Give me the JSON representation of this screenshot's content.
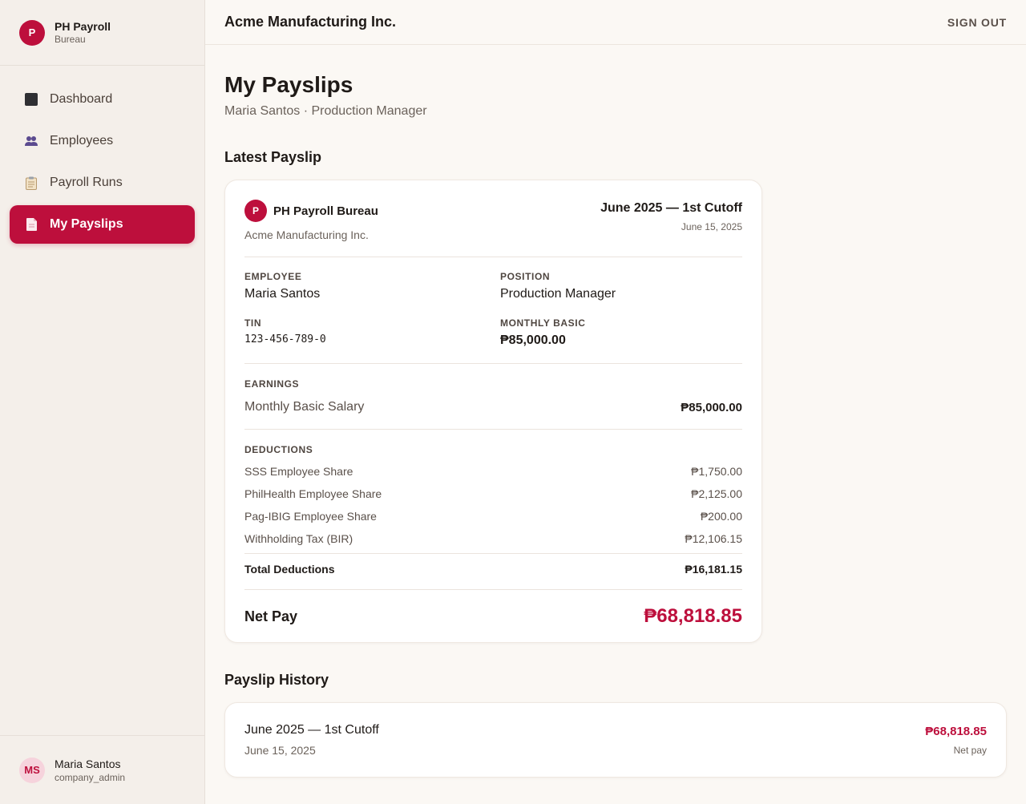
{
  "sidebar": {
    "brand_initial": "P",
    "brand_name": "PH Payroll",
    "brand_sub": "Bureau",
    "items": [
      {
        "label": "Dashboard",
        "icon": "dashboard-square-icon",
        "active": false
      },
      {
        "label": "Employees",
        "icon": "people-icon",
        "active": false
      },
      {
        "label": "Payroll Runs",
        "icon": "clipboard-icon",
        "active": false
      },
      {
        "label": "My Payslips",
        "icon": "document-icon",
        "active": true
      }
    ],
    "user": {
      "initials": "MS",
      "name": "Maria Santos",
      "role": "company_admin"
    }
  },
  "header": {
    "company": "Acme Manufacturing Inc.",
    "signout": "SIGN OUT"
  },
  "page": {
    "title": "My Payslips",
    "subtitle": "Maria Santos · Production Manager"
  },
  "latest": {
    "section_title": "Latest Payslip",
    "bureau_initial": "P",
    "bureau": "PH Payroll Bureau",
    "company": "Acme Manufacturing Inc.",
    "period": "June 2025 — 1st Cutoff",
    "date": "June 15, 2025",
    "employee_label": "EMPLOYEE",
    "employee": "Maria Santos",
    "position_label": "POSITION",
    "position": "Production Manager",
    "tin_label": "TIN",
    "tin": "123-456-789-0",
    "basic_label": "MONTHLY BASIC",
    "basic": "₱85,000.00",
    "earnings_label": "EARNINGS",
    "earnings": [
      {
        "name": "Monthly Basic Salary",
        "amount": "₱85,000.00"
      }
    ],
    "deductions_label": "DEDUCTIONS",
    "deductions": [
      {
        "name": "SSS Employee Share",
        "amount": "₱1,750.00"
      },
      {
        "name": "PhilHealth Employee Share",
        "amount": "₱2,125.00"
      },
      {
        "name": "Pag-IBIG Employee Share",
        "amount": "₱200.00"
      },
      {
        "name": "Withholding Tax (BIR)",
        "amount": "₱12,106.15"
      }
    ],
    "total_deductions_label": "Total Deductions",
    "total_deductions": "₱16,181.15",
    "net_pay_label": "Net Pay",
    "net_pay": "₱68,818.85"
  },
  "history": {
    "section_title": "Payslip History",
    "items": [
      {
        "period": "June 2025 — 1st Cutoff",
        "date": "June 15, 2025",
        "amount": "₱68,818.85",
        "sub": "Net pay"
      }
    ]
  },
  "colors": {
    "accent": "#bd0f3c",
    "background": "#fbf8f4",
    "sidebar": "#f4efea"
  }
}
